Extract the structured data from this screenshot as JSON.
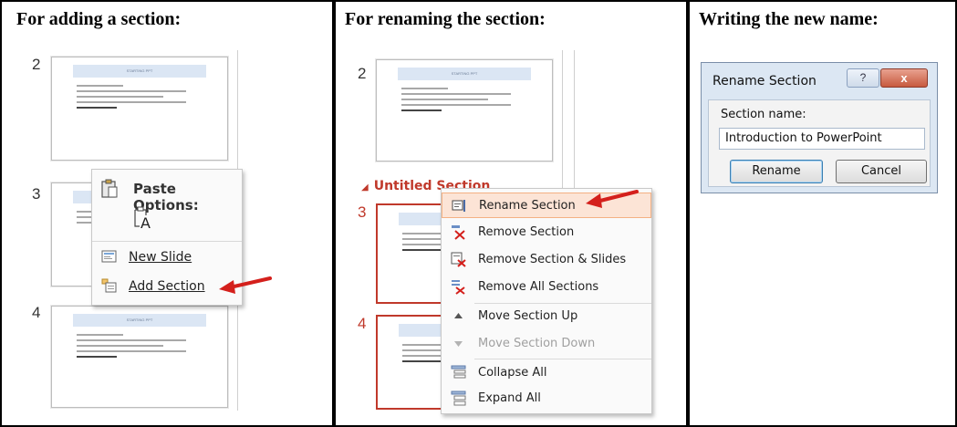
{
  "headers": {
    "col1": "For adding a section:",
    "col2": "For renaming the section:",
    "col3": "Writing the new name:"
  },
  "panel1": {
    "slides": [
      {
        "number": "2",
        "title": "STARTING PPT"
      },
      {
        "number": "3",
        "title": "STARTING PPT"
      },
      {
        "number": "4",
        "title": "STARTING PPT"
      }
    ],
    "menu": {
      "paste_options_label": "Paste Options:",
      "paste_icon": "paste-keep-text-icon",
      "items": [
        {
          "label": "New Slide",
          "icon": "new-slide-icon"
        },
        {
          "label": "Add Section",
          "icon": "add-section-icon"
        }
      ]
    }
  },
  "panel2": {
    "slides": [
      {
        "number": "2",
        "title": "STARTING PPT"
      },
      {
        "number": "3",
        "title": "STARTING PPT"
      },
      {
        "number": "4",
        "title": "STARTING PPT"
      }
    ],
    "section_header": "Untitled Section",
    "menu": {
      "items": [
        {
          "label": "Rename Section",
          "icon": "rename-section-icon",
          "highlighted": true,
          "disabled": false
        },
        {
          "label": "Remove Section",
          "icon": "remove-section-icon",
          "highlighted": false,
          "disabled": false
        },
        {
          "label": "Remove Section & Slides",
          "icon": "remove-section-slides-icon",
          "highlighted": false,
          "disabled": false
        },
        {
          "label": "Remove All Sections",
          "icon": "remove-all-sections-icon",
          "highlighted": false,
          "disabled": false
        },
        {
          "label": "Move Section Up",
          "icon": "triangle-up-icon",
          "highlighted": false,
          "disabled": false
        },
        {
          "label": "Move Section Down",
          "icon": "triangle-down-icon",
          "highlighted": false,
          "disabled": true
        },
        {
          "label": "Collapse All",
          "icon": "collapse-all-icon",
          "highlighted": false,
          "disabled": false
        },
        {
          "label": "Expand All",
          "icon": "expand-all-icon",
          "highlighted": false,
          "disabled": false
        }
      ]
    }
  },
  "dialog": {
    "title": "Rename Section",
    "help_glyph": "?",
    "close_glyph": "x",
    "field_label": "Section name:",
    "field_value": "Introduction to PowerPoint",
    "rename_button": "Rename",
    "cancel_button": "Cancel"
  },
  "colors": {
    "arrow": "#d4201c",
    "section_header": "#c0392b",
    "selected_slide_border": "#c0392b",
    "menu_highlight": "#fce4d6"
  }
}
